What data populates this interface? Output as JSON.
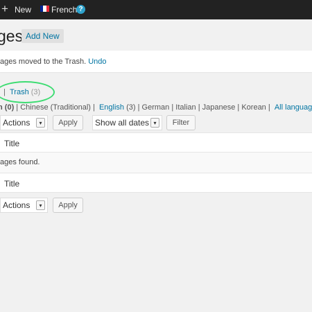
{
  "adminbar": {
    "new_label": "New",
    "language_label": "French",
    "help_symbol": "?",
    "flag_colors": [
      "#002395",
      "#ffffff",
      "#ed2939"
    ]
  },
  "heading": {
    "title_fragment": "ges",
    "add_new_label": "Add New"
  },
  "notice": {
    "text": "ages moved to the Trash.",
    "undo_label": "Undo"
  },
  "views": {
    "separator": "|",
    "trash_label": "Trash",
    "trash_count": "(3)"
  },
  "languages": {
    "prefix": "n",
    "prefix_count": "(0)",
    "chinese_trad": "Chinese (Traditional)",
    "english": "English",
    "english_count": "(3)",
    "german": "German",
    "italian": "Italian",
    "japanese": "Japanese",
    "korean": "Korean",
    "all_languages": "All languages"
  },
  "toolbar_top": {
    "bulk_actions": "Actions",
    "apply": "Apply",
    "dates": "Show all dates",
    "filter": "Filter"
  },
  "table": {
    "header_title": "Title",
    "empty_message": "ages found.",
    "footer_title": "Title"
  },
  "toolbar_bottom": {
    "bulk_actions": "Actions",
    "apply": "Apply"
  }
}
